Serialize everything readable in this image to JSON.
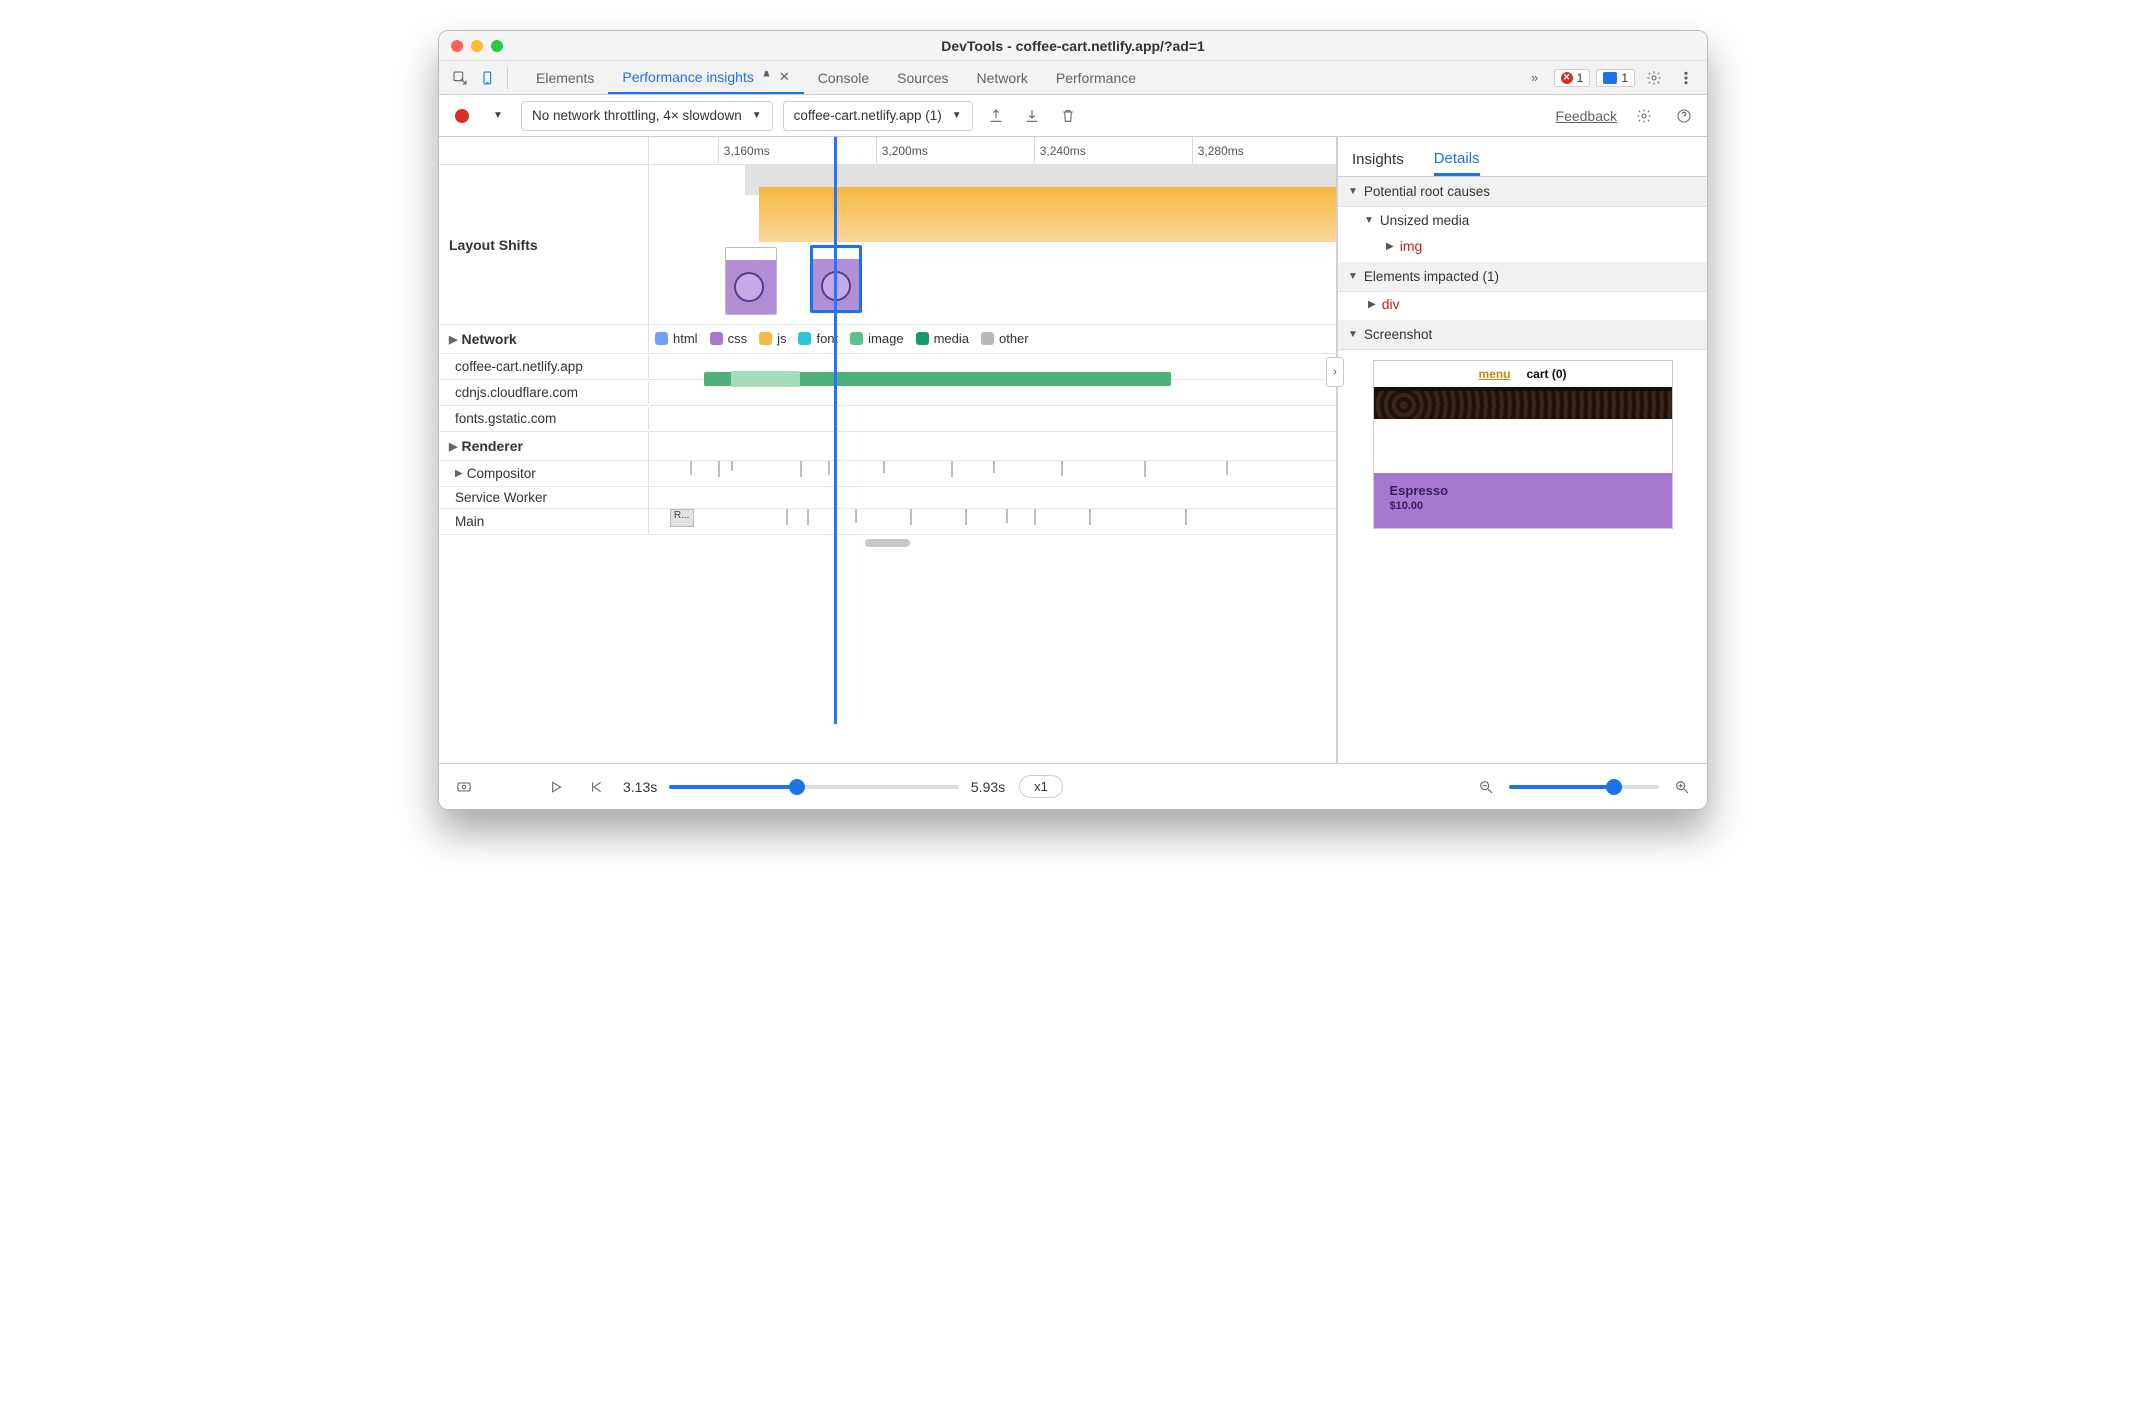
{
  "window": {
    "title": "DevTools - coffee-cart.netlify.app/?ad=1"
  },
  "tabs": {
    "elements": "Elements",
    "perf_insights": "Performance insights",
    "console": "Console",
    "sources": "Sources",
    "network_tab": "Network",
    "performance": "Performance",
    "more_glyph": "»",
    "error_count": "1",
    "message_count": "1"
  },
  "toolbar": {
    "throttling": "No network throttling, 4× slowdown",
    "page_select": "coffee-cart.netlify.app (1)",
    "feedback": "Feedback"
  },
  "ruler": {
    "t0": "3,160ms",
    "t1": "3,200ms",
    "t2": "3,240ms",
    "t3": "3,280ms"
  },
  "sections": {
    "layout_shifts": "Layout Shifts",
    "network": "Network",
    "renderer": "Renderer",
    "compositor": "Compositor",
    "service_worker": "Service Worker",
    "main": "Main",
    "main_task": "R..."
  },
  "legend": {
    "html": "html",
    "css": "css",
    "js": "js",
    "font": "font",
    "image": "image",
    "media": "media",
    "other": "other"
  },
  "network_hosts": {
    "h0": "coffee-cart.netlify.app",
    "h1": "cdnjs.cloudflare.com",
    "h2": "fonts.gstatic.com"
  },
  "details": {
    "tab_insights": "Insights",
    "tab_details": "Details",
    "root_causes": "Potential root causes",
    "unsized_media": "Unsized media",
    "img": "img",
    "elements_impacted": "Elements impacted (1)",
    "div": "div",
    "screenshot": "Screenshot"
  },
  "preview": {
    "menu": "menu",
    "cart": "cart (0)",
    "product_name": "Espresso",
    "product_price": "$10.00"
  },
  "bottombar": {
    "start_time": "3.13s",
    "end_time": "5.93s",
    "speed": "x1",
    "collapse_glyph": "›"
  }
}
